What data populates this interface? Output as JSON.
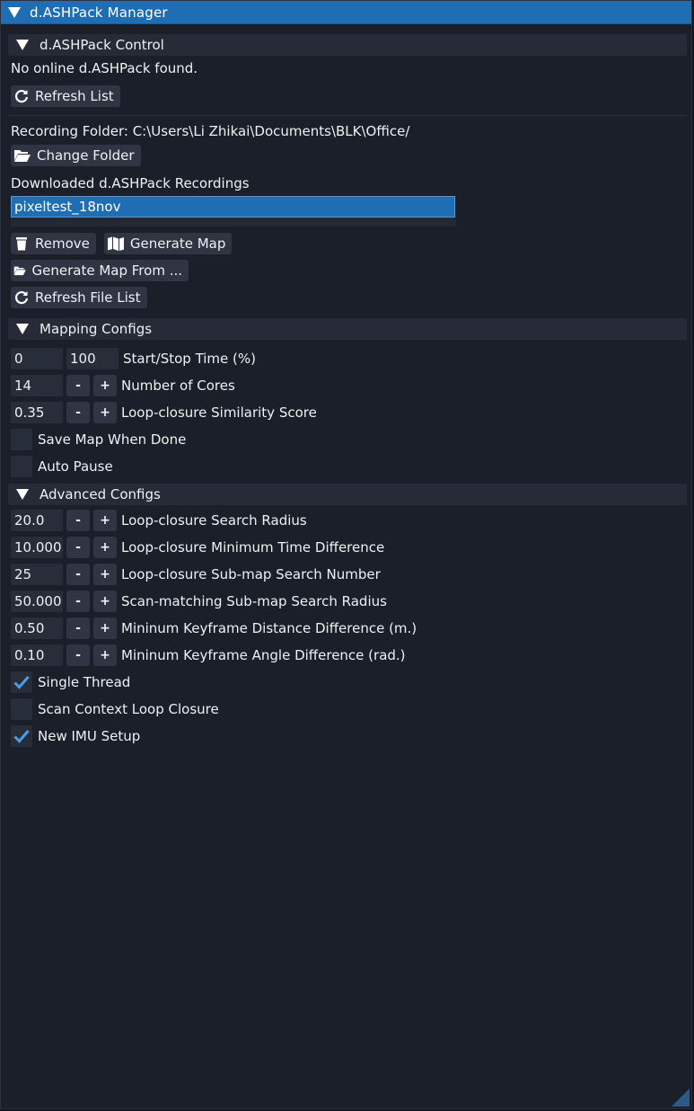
{
  "window": {
    "title": "d.ASHPack Manager"
  },
  "control": {
    "header": "d.ASHPack Control",
    "status": "No online d.ASHPack found.",
    "refresh_list": "Refresh List",
    "recording_folder": "Recording Folder: C:\\Users\\Li Zhikai\\Documents\\BLK\\Office/",
    "change_folder": "Change Folder",
    "downloaded_label": "Downloaded d.ASHPack Recordings",
    "recordings": [
      "pixeltest_18nov"
    ],
    "remove": "Remove",
    "generate_map": "Generate Map",
    "generate_map_from": "Generate Map From ...",
    "refresh_file_list": "Refresh File List"
  },
  "mapping": {
    "header": "Mapping Configs",
    "start_value": "0",
    "stop_value": "100",
    "start_stop_label": "Start/Stop Time (%)",
    "cores_value": "14",
    "cores_label": "Number of Cores",
    "similarity_value": "0.35",
    "similarity_label": "Loop-closure Similarity Score",
    "save_map_label": "Save Map When Done",
    "save_map_checked": false,
    "auto_pause_label": "Auto Pause",
    "auto_pause_checked": false
  },
  "advanced": {
    "header": "Advanced Configs",
    "params": [
      {
        "value": "20.0",
        "label": "Loop-closure Search Radius"
      },
      {
        "value": "10.000",
        "label": "Loop-closure Minimum Time Difference"
      },
      {
        "value": "25",
        "label": "Loop-closure Sub-map Search Number"
      },
      {
        "value": "50.000",
        "label": "Scan-matching Sub-map Search Radius"
      },
      {
        "value": "0.50",
        "label": "Mininum Keyframe Distance Difference (m.)"
      },
      {
        "value": "0.10",
        "label": "Mininum Keyframe Angle Difference (rad.)"
      }
    ],
    "single_thread_label": "Single Thread",
    "single_thread_checked": true,
    "scan_context_label": "Scan Context Loop Closure",
    "scan_context_checked": false,
    "new_imu_label": "New IMU Setup",
    "new_imu_checked": true
  },
  "stepper": {
    "minus": "-",
    "plus": "+"
  },
  "colors": {
    "accent": "#1f6db3",
    "background": "#1a1f29",
    "check": "#4a9ee8"
  }
}
